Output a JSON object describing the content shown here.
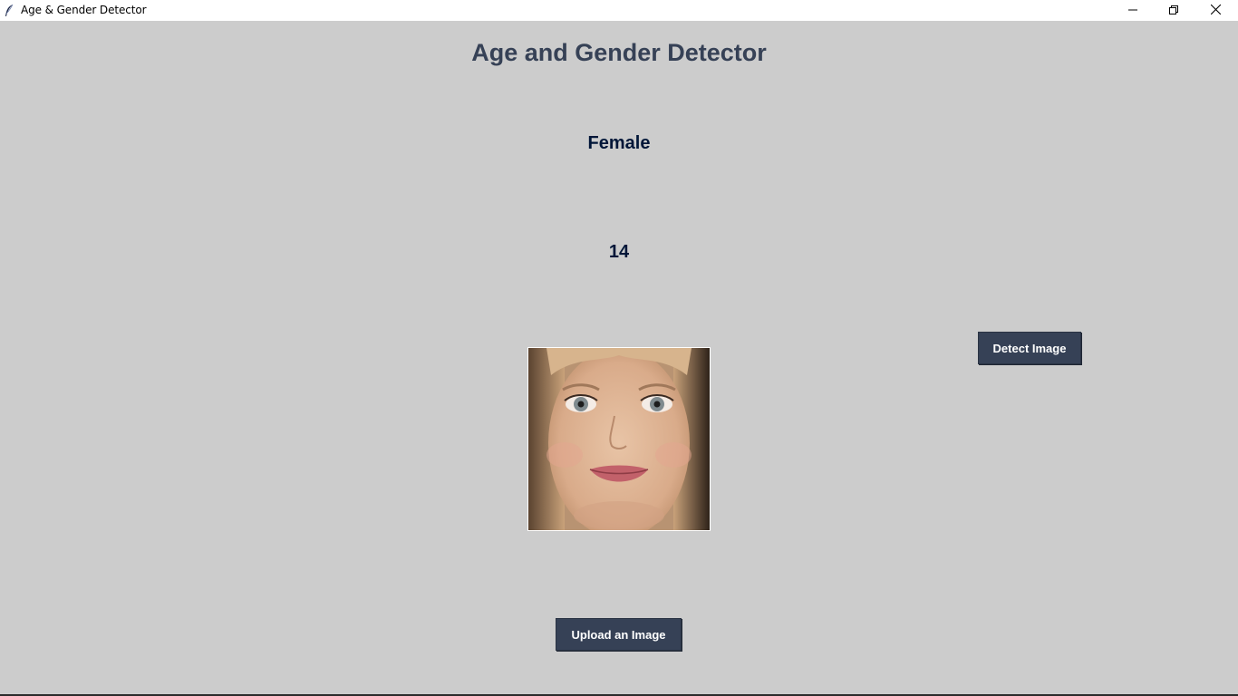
{
  "window": {
    "title": "Age & Gender Detector",
    "app_icon": "feather-icon",
    "controls": [
      "minimize-icon",
      "restore-icon",
      "close-icon"
    ]
  },
  "main": {
    "heading": "Age and Gender Detector",
    "gender_result": "Female",
    "age_result": "14",
    "image_alt": "uploaded face photo"
  },
  "buttons": {
    "detect_label": "Detect Image",
    "upload_label": "Upload an Image"
  },
  "colors": {
    "background": "#cccccc",
    "heading": "#364156",
    "result_text": "#011638",
    "button_bg": "#364156",
    "button_text": "#ffffff"
  }
}
